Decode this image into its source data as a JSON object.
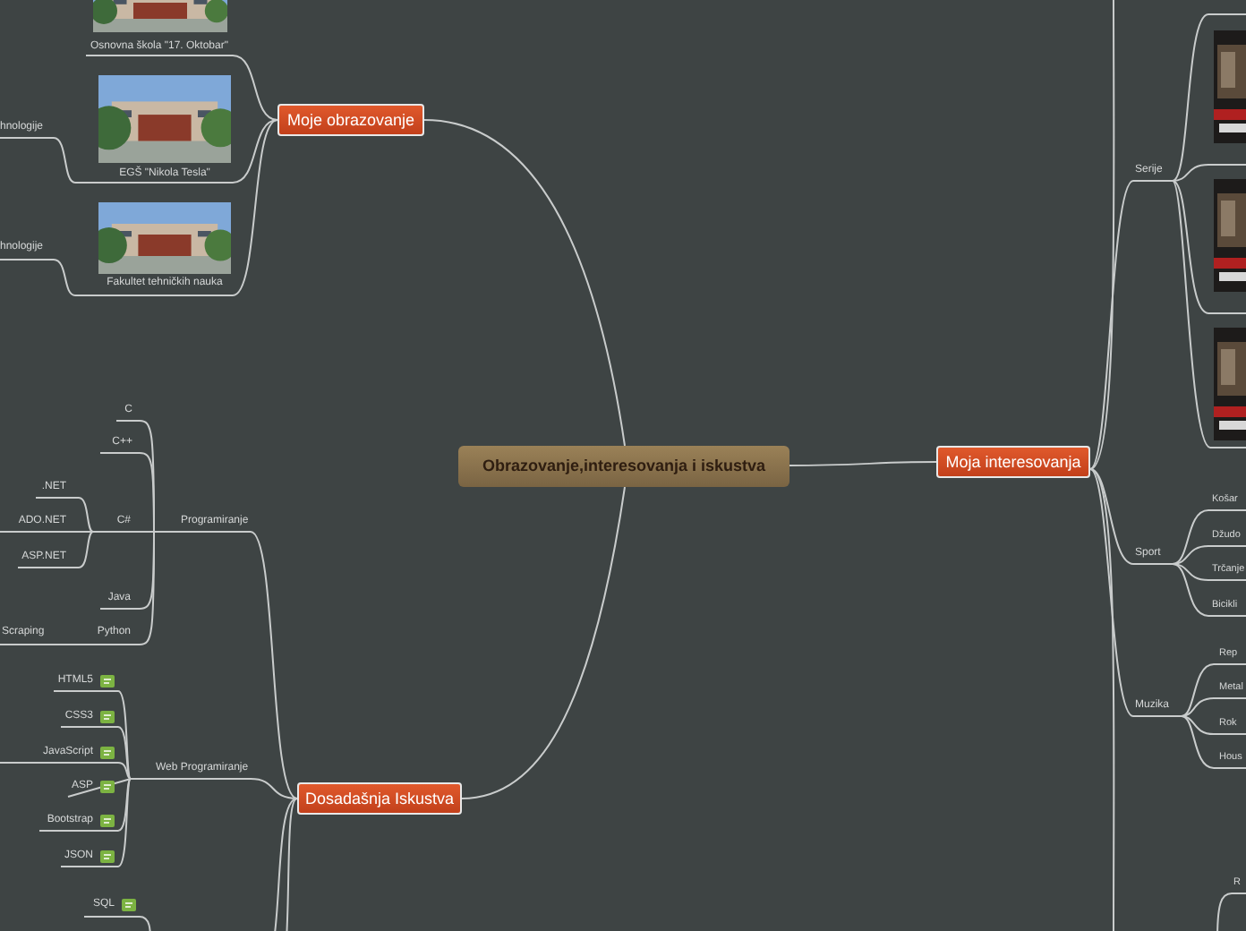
{
  "central_topic": {
    "title": "Obrazovanje,interesovanja i iskustva"
  },
  "topics": [
    {
      "title": "Moje obrazovanje",
      "children": [
        {
          "kind": "picture",
          "caption": "Osnovna škola \"17. Oktobar\""
        },
        {
          "kind": "picture",
          "caption": "EGŠ \"Nikola Tesla\"",
          "children": [
            {
              "title": "hnologije"
            }
          ]
        },
        {
          "kind": "picture",
          "caption": "Fakultet tehničkih nauka",
          "children": [
            {
              "title": "hnologije"
            }
          ]
        }
      ]
    },
    {
      "title": "Dosadašnja Iskustva",
      "children": [
        {
          "title": "Programiranje",
          "children": [
            {
              "title": "C"
            },
            {
              "title": "C++"
            },
            {
              "title": "C#",
              "children": [
                {
                  "title": ".NET"
                },
                {
                  "title": "ADO.NET"
                },
                {
                  "title": "ASP.NET"
                }
              ]
            },
            {
              "title": "Java"
            },
            {
              "title": "Python",
              "children": [
                {
                  "title": "Scraping"
                }
              ]
            }
          ]
        },
        {
          "title": "Web Programiranje",
          "children": [
            {
              "title": "HTML5",
              "kind": "tagged"
            },
            {
              "title": "CSS3",
              "kind": "tagged"
            },
            {
              "title": "JavaScript",
              "kind": "tagged"
            },
            {
              "title": "ASP",
              "kind": "tagged"
            },
            {
              "title": "Bootstrap",
              "kind": "tagged"
            },
            {
              "title": "JSON",
              "kind": "tagged"
            }
          ]
        },
        {
          "children": [
            {
              "title": "SQL",
              "kind": "tagged"
            }
          ]
        }
      ]
    },
    {
      "title": "Moja interesovanja",
      "children": [
        {
          "title": "Serije"
        },
        {
          "title": "Sport",
          "children": [
            {
              "title": "Košar"
            },
            {
              "title": "Džudo"
            },
            {
              "title": "Trčanje"
            },
            {
              "title": "Bicikli"
            }
          ]
        },
        {
          "title": "Muzika",
          "children": [
            {
              "title": "Rep"
            },
            {
              "title": "Metal"
            },
            {
              "title": "Rok"
            },
            {
              "title": "Hous"
            }
          ]
        },
        {
          "children": [
            {
              "title": "R"
            }
          ]
        }
      ]
    }
  ]
}
